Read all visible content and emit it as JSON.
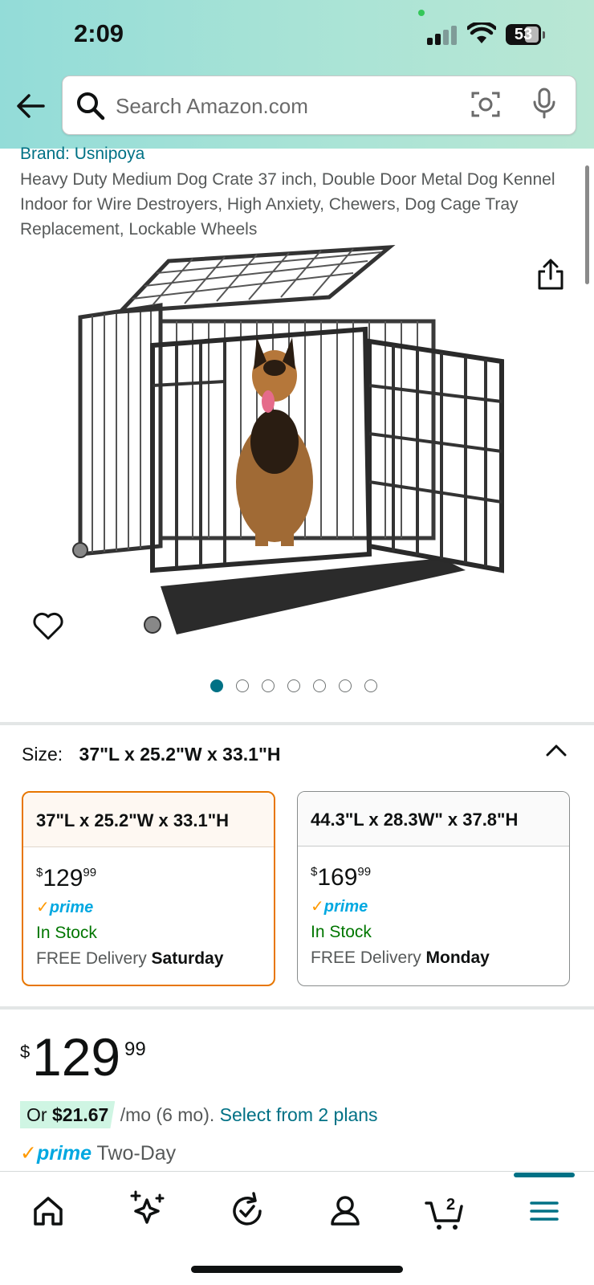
{
  "status_bar": {
    "time": "2:09",
    "battery": "53"
  },
  "search": {
    "placeholder": "Search Amazon.com"
  },
  "product": {
    "brand": "Brand: Usnipoya",
    "title": "Heavy Duty Medium Dog Crate 37 inch, Double Door Metal Dog Kennel Indoor for Wire Destroyers, High Anxiety, Chewers, Dog Cage Tray Replacement, Lockable Wheels",
    "image_count": 7,
    "active_image_index": 0
  },
  "size": {
    "label": "Size:",
    "selected": "37\"L x 25.2\"W x 33.1\"H",
    "options": [
      {
        "name": "37\"L x 25.2\"W x 33.1\"H",
        "price_currency": "$",
        "price_whole": "129",
        "price_fraction": "99",
        "prime": "prime",
        "stock": "In Stock",
        "delivery_prefix": "FREE Delivery ",
        "delivery_day": "Saturday"
      },
      {
        "name": "44.3\"L x 28.3W\" x 37.8\"H",
        "price_currency": "$",
        "price_whole": "169",
        "price_fraction": "99",
        "prime": "prime",
        "stock": "In Stock",
        "delivery_prefix": "FREE Delivery ",
        "delivery_day": "Monday"
      }
    ]
  },
  "price": {
    "currency": "$",
    "whole": "129",
    "fraction": "99"
  },
  "financing": {
    "or": "Or ",
    "amount": "$21.67",
    "term": " /mo (6 mo). ",
    "link": "Select from 2 plans"
  },
  "shipping": {
    "check": "✓",
    "prime": "prime",
    "text": " Two-Day"
  },
  "tabbar": {
    "cart_count": "2",
    "active_tab": "menu"
  },
  "colors": {
    "link": "#007185",
    "prime_blue": "#00a8e1",
    "prime_check": "#ff9900",
    "in_stock": "#007600",
    "selected_border": "#e77600"
  }
}
